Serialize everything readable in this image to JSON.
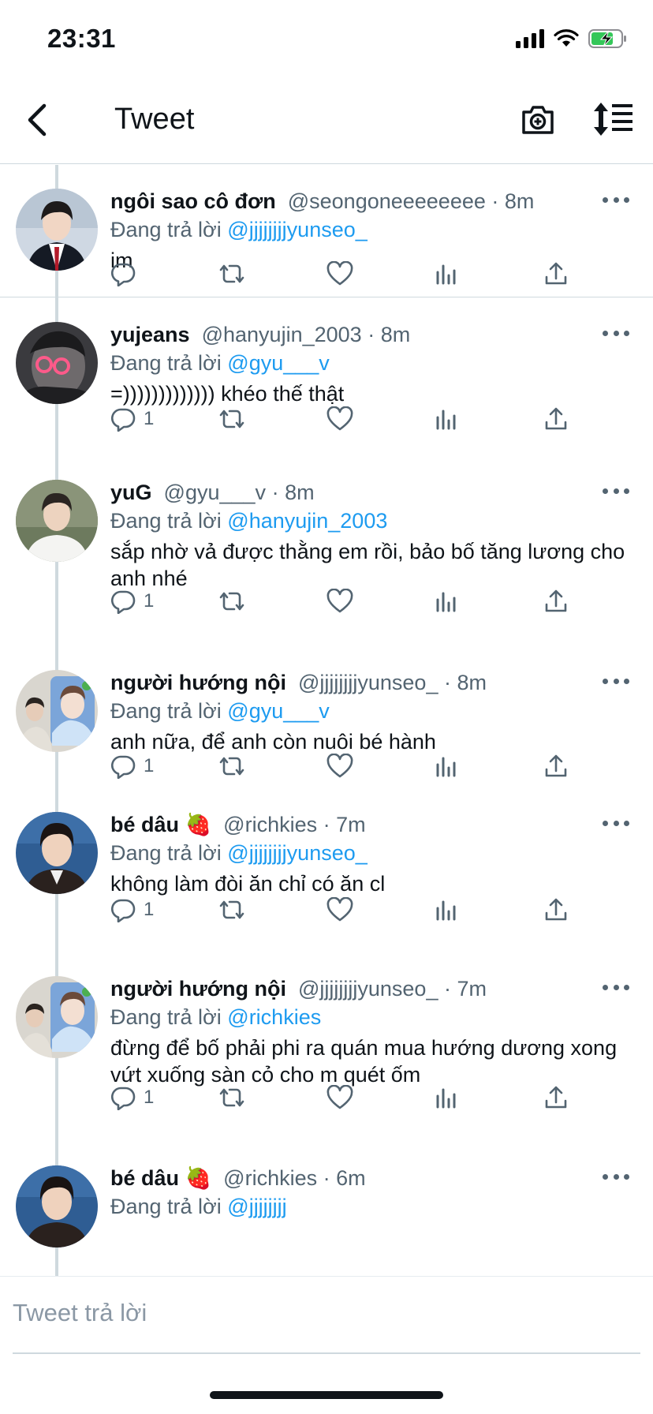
{
  "status_bar": {
    "time": "23:31"
  },
  "nav": {
    "title": "Tweet"
  },
  "reply_prefix": "Đang trả lời",
  "tweets": [
    {
      "name": "ngôi sao cô đơn",
      "handle": "@seongoneeeeeeee",
      "time": "8m",
      "reply_to": "@jjjjjjjjyunseo_",
      "text": "im",
      "replies": ""
    },
    {
      "name": "yujeans",
      "handle": "@hanyujin_2003",
      "time": "8m",
      "reply_to": "@gyu___v",
      "text": "=))))))))))))) khéo thế thật",
      "replies": "1"
    },
    {
      "name": "yuG",
      "handle": "@gyu___v",
      "time": "8m",
      "reply_to": "@hanyujin_2003",
      "text": "sắp nhờ vả được thằng em rồi, bảo bố tăng lương cho anh nhé",
      "replies": "1"
    },
    {
      "name": "người hướng nội",
      "handle": "@jjjjjjjjyunseo_",
      "time": "8m",
      "reply_to": "@gyu___v",
      "text": "anh nữa, để anh còn nuôi bé hành",
      "replies": "1"
    },
    {
      "name": "bé dâu 🍓",
      "handle": "@richkies",
      "time": "7m",
      "reply_to": "@jjjjjjjjyunseo_",
      "text": "không làm đòi ăn chỉ có ăn cl",
      "replies": "1"
    },
    {
      "name": "người hướng nội",
      "handle": "@jjjjjjjjyunseo_",
      "time": "7m",
      "reply_to": "@richkies",
      "text": "đừng để bố phải phi ra quán mua hướng dương xong vứt xuống sàn cỏ cho m quét ốm",
      "replies": "1"
    },
    {
      "name": "bé dâu 🍓",
      "handle": "@richkies",
      "time": "6m",
      "reply_to": "@jjjjjjjj",
      "text": "",
      "replies": ""
    }
  ],
  "composer": {
    "placeholder": "Tweet trả lời"
  },
  "icons": {
    "back": "chevron-left-icon",
    "camera": "camera-plus-icon",
    "sort": "sort-icon",
    "reply": "reply-icon",
    "retweet": "retweet-icon",
    "like": "heart-icon",
    "stats": "analytics-icon",
    "share": "share-icon",
    "more": "more-icon"
  },
  "colors": {
    "accent": "#1d9bf0",
    "secondary_text": "#536471",
    "battery": "#34c759"
  }
}
